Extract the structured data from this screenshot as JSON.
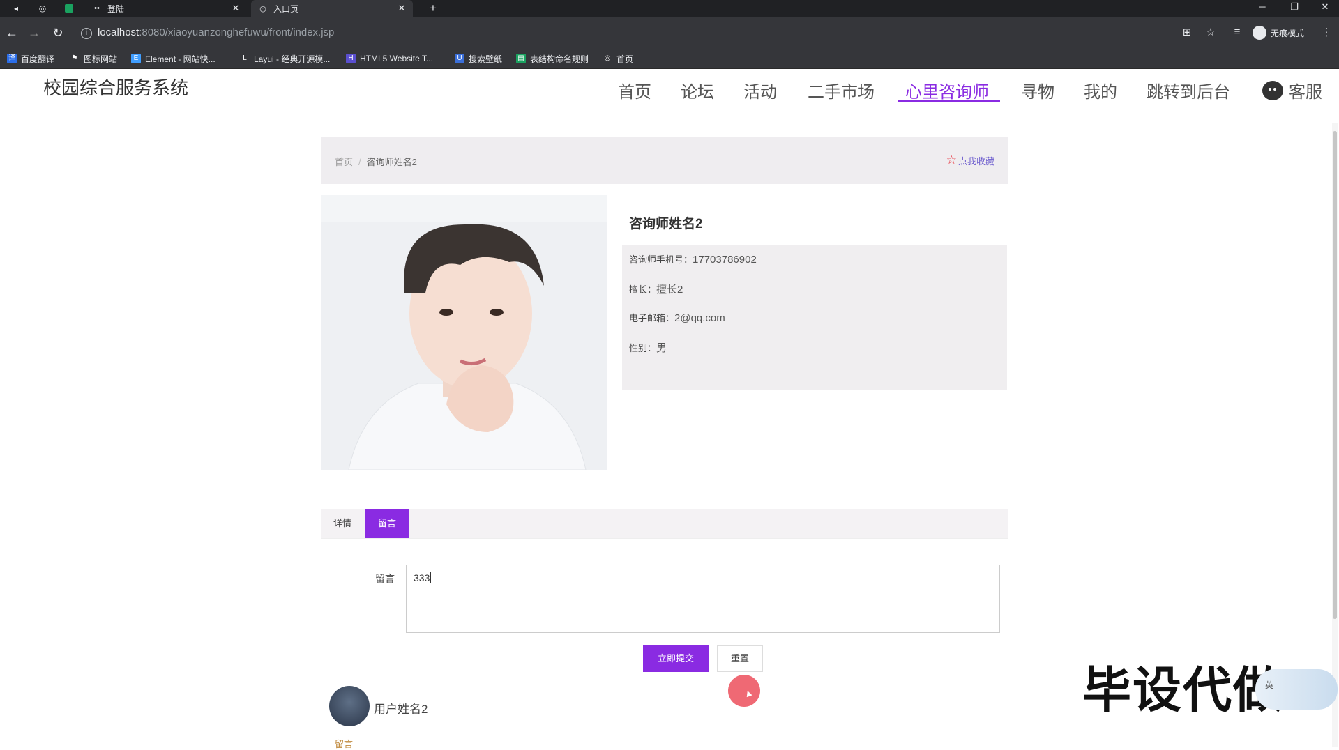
{
  "browser": {
    "tabs": [
      {
        "title": "登陆",
        "active": false
      },
      {
        "title": "入口页",
        "active": true
      }
    ],
    "url_host": "localhost",
    "url_path": ":8080/xiaoyuanzonghefuwu/front/index.jsp",
    "incognito_label": "无痕模式",
    "bookmarks": [
      "百度翻译",
      "图标网站",
      "Element - 网站快...",
      "Layui - 经典开源模...",
      "HTML5 Website T...",
      "搜索壁纸",
      "表结构命名规则",
      "首页"
    ]
  },
  "site": {
    "title": "校园综合服务系统",
    "nav": [
      "首页",
      "论坛",
      "活动",
      "二手市场",
      "心里咨询师",
      "寻物",
      "我的",
      "跳转到后台"
    ],
    "nav_active": "心里咨询师",
    "service_label": "客服",
    "accent_color": "#8a2be2"
  },
  "breadcrumb": {
    "home": "首页",
    "separator": "/",
    "current": "咨询师姓名2",
    "favorite_label": "点我收藏"
  },
  "counselor": {
    "name": "咨询师姓名2",
    "phone_label": "咨询师手机号：",
    "phone": "17703786902",
    "specialty_label": "擅长：",
    "specialty": "擅长2",
    "email_label": "电子邮箱：",
    "email": "2@qq.com",
    "gender_label": "性别：",
    "gender": "男"
  },
  "tabs": {
    "details": "详情",
    "message": "留言",
    "active": "留言"
  },
  "form": {
    "label": "留言",
    "value": "333",
    "submit": "立即提交",
    "reset": "重置"
  },
  "comment": {
    "user": "用户姓名2",
    "text": "留言"
  },
  "watermark": "毕设代做",
  "ime_label": "英"
}
